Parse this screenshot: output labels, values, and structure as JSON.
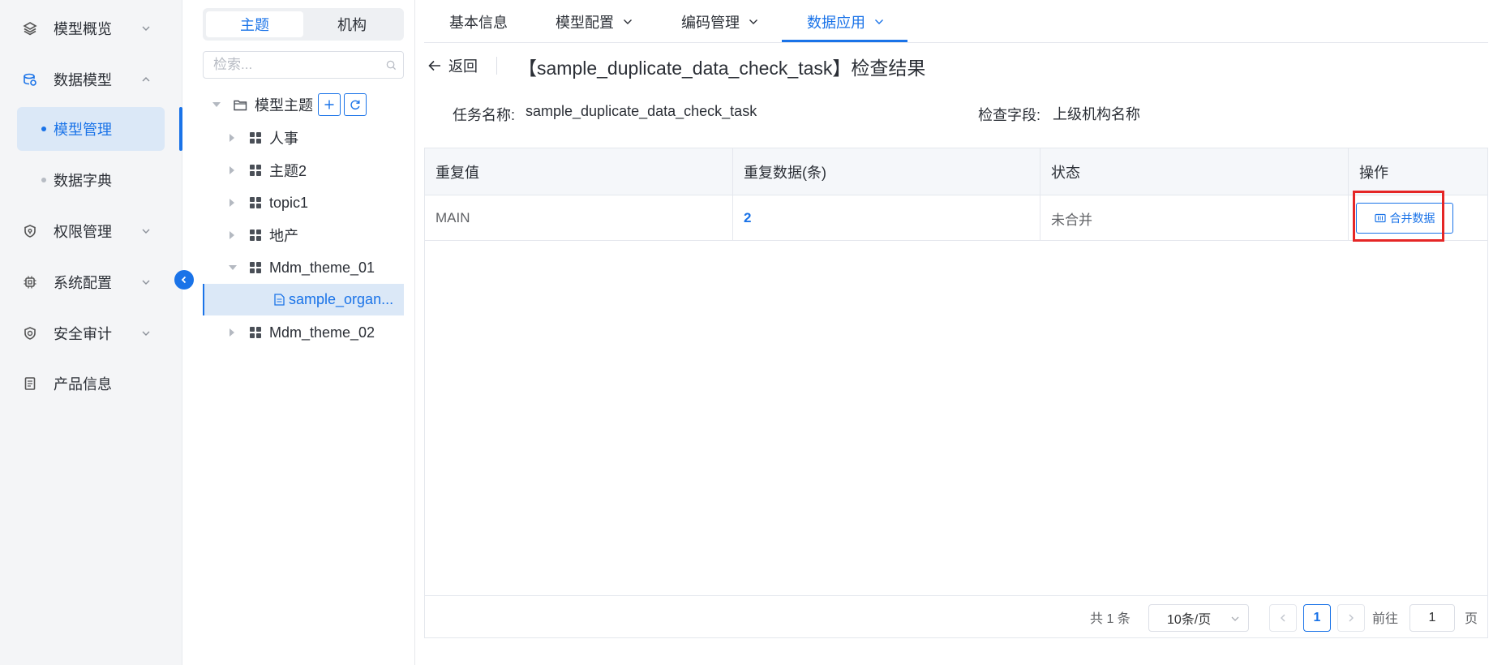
{
  "nav": {
    "items": [
      {
        "label": "模型概览",
        "icon": "layers-icon",
        "expanded": false
      },
      {
        "label": "数据模型",
        "icon": "database-icon",
        "expanded": true
      },
      {
        "label": "权限管理",
        "icon": "shield-icon",
        "expanded": false
      },
      {
        "label": "系统配置",
        "icon": "chip-icon",
        "expanded": false
      },
      {
        "label": "安全审计",
        "icon": "audit-shield-icon",
        "expanded": false
      },
      {
        "label": "产品信息",
        "icon": "document-icon",
        "expanded": false
      }
    ],
    "subitems": [
      {
        "label": "模型管理",
        "active": true
      },
      {
        "label": "数据字典",
        "active": false
      }
    ]
  },
  "tree": {
    "segments": [
      "主题",
      "机构"
    ],
    "active_segment": "主题",
    "search_placeholder": "检索...",
    "root_label": "模型主题",
    "nodes": [
      {
        "label": "人事",
        "expanded": false
      },
      {
        "label": "主题2",
        "expanded": false
      },
      {
        "label": "topic1",
        "expanded": false
      },
      {
        "label": "地产",
        "expanded": false
      },
      {
        "label": "Mdm_theme_01",
        "expanded": true
      },
      {
        "label": "sample_organ...",
        "selected": true
      },
      {
        "label": "Mdm_theme_02",
        "expanded": false
      }
    ]
  },
  "tabs": [
    {
      "label": "基本信息",
      "dropdown": false,
      "active": false
    },
    {
      "label": "模型配置",
      "dropdown": true,
      "active": false
    },
    {
      "label": "编码管理",
      "dropdown": true,
      "active": false
    },
    {
      "label": "数据应用",
      "dropdown": true,
      "active": true
    }
  ],
  "page": {
    "back_label": "返回",
    "title": "【sample_duplicate_data_check_task】检查结果",
    "task_name_label": "任务名称:",
    "task_name_value": "sample_duplicate_data_check_task",
    "check_field_label": "检查字段:",
    "check_field_value": "上级机构名称"
  },
  "table": {
    "headers": [
      "重复值",
      "重复数据(条)",
      "状态",
      "操作"
    ],
    "rows": [
      {
        "value": "MAIN",
        "count": "2",
        "status": "未合并",
        "action": "合并数据"
      }
    ]
  },
  "pagination": {
    "total": "共 1 条",
    "page_size": "10条/页",
    "current_page": "1",
    "goto_label": "前往",
    "goto_value": "1",
    "page_suffix": "页"
  },
  "colors": {
    "accent": "#1a73e8",
    "highlight_box": "#e52626",
    "nav_bg": "#f4f5f7",
    "active_bg": "#dbe8f7"
  }
}
